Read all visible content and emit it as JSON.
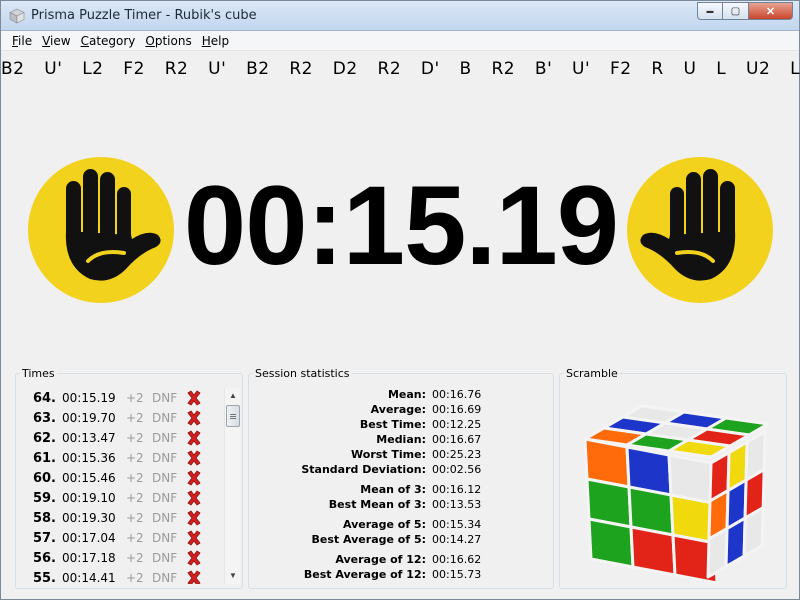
{
  "window": {
    "title": "Prisma Puzzle Timer - Rubik's cube",
    "buttons": {
      "minimize": "▬",
      "maximize": "▢",
      "close": "✕"
    }
  },
  "menu": [
    {
      "u": "F",
      "rest": "ile"
    },
    {
      "u": "V",
      "rest": "iew"
    },
    {
      "u": "C",
      "rest": "ategory"
    },
    {
      "u": "O",
      "rest": "ptions"
    },
    {
      "u": "H",
      "rest": "elp"
    }
  ],
  "scramble": "B2  U'  L2  F2  R2  U'  B2  R2  D2  R2  D'  B  R2  B'  U'  F2  R  U  L  U2  L'",
  "timer": "00:15.19",
  "colors": {
    "hand_bg": "#f2d21c",
    "hand_fg": "#111111",
    "delete": "#d4201f"
  },
  "times_panel": {
    "title": "Times",
    "rows": [
      {
        "num": "64.",
        "time": "00:15.19",
        "plus2": "+2",
        "dnf": "DNF"
      },
      {
        "num": "63.",
        "time": "00:19.70",
        "plus2": "+2",
        "dnf": "DNF"
      },
      {
        "num": "62.",
        "time": "00:13.47",
        "plus2": "+2",
        "dnf": "DNF"
      },
      {
        "num": "61.",
        "time": "00:15.36",
        "plus2": "+2",
        "dnf": "DNF"
      },
      {
        "num": "60.",
        "time": "00:15.46",
        "plus2": "+2",
        "dnf": "DNF"
      },
      {
        "num": "59.",
        "time": "00:19.10",
        "plus2": "+2",
        "dnf": "DNF"
      },
      {
        "num": "58.",
        "time": "00:19.30",
        "plus2": "+2",
        "dnf": "DNF"
      },
      {
        "num": "57.",
        "time": "00:17.04",
        "plus2": "+2",
        "dnf": "DNF"
      },
      {
        "num": "56.",
        "time": "00:17.18",
        "plus2": "+2",
        "dnf": "DNF"
      },
      {
        "num": "55.",
        "time": "00:14.41",
        "plus2": "+2",
        "dnf": "DNF"
      }
    ]
  },
  "stats_panel": {
    "title": "Session statistics",
    "groups": [
      [
        {
          "label": "Mean:",
          "value": "00:16.76"
        },
        {
          "label": "Average:",
          "value": "00:16.69"
        },
        {
          "label": "Best Time:",
          "value": "00:12.25"
        },
        {
          "label": "Median:",
          "value": "00:16.67"
        },
        {
          "label": "Worst Time:",
          "value": "00:25.23"
        },
        {
          "label": "Standard Deviation:",
          "value": "00:02.56"
        }
      ],
      [
        {
          "label": "Mean of 3:",
          "value": "00:16.12"
        },
        {
          "label": "Best Mean of 3:",
          "value": "00:13.53"
        }
      ],
      [
        {
          "label": "Average of 5:",
          "value": "00:15.34"
        },
        {
          "label": "Best Average of 5:",
          "value": "00:14.27"
        }
      ],
      [
        {
          "label": "Average of 12:",
          "value": "00:16.62"
        },
        {
          "label": "Best Average of 12:",
          "value": "00:15.73"
        }
      ]
    ]
  },
  "scramble_panel": {
    "title": "Scramble",
    "cube_colors": {
      "top": [
        [
          "#e8e8e8",
          "#1d35c8",
          "#1ea31e"
        ],
        [
          "#1d35c8",
          "#e8e8e8",
          "#e22418"
        ],
        [
          "#ff6a0a",
          "#1ea31e",
          "#f0d90d"
        ]
      ],
      "front": [
        [
          "#ff6a0a",
          "#1d35c8",
          "#e8e8e8"
        ],
        [
          "#1ea31e",
          "#1ea31e",
          "#f0d90d"
        ],
        [
          "#1ea31e",
          "#e22418",
          "#e22418"
        ]
      ],
      "right": [
        [
          "#e22418",
          "#f0d90d",
          "#e8e8e8"
        ],
        [
          "#ff6a0a",
          "#1d35c8",
          "#e22418"
        ],
        [
          "#e8e8e8",
          "#1d35c8",
          "#e8e8e8"
        ]
      ]
    }
  }
}
